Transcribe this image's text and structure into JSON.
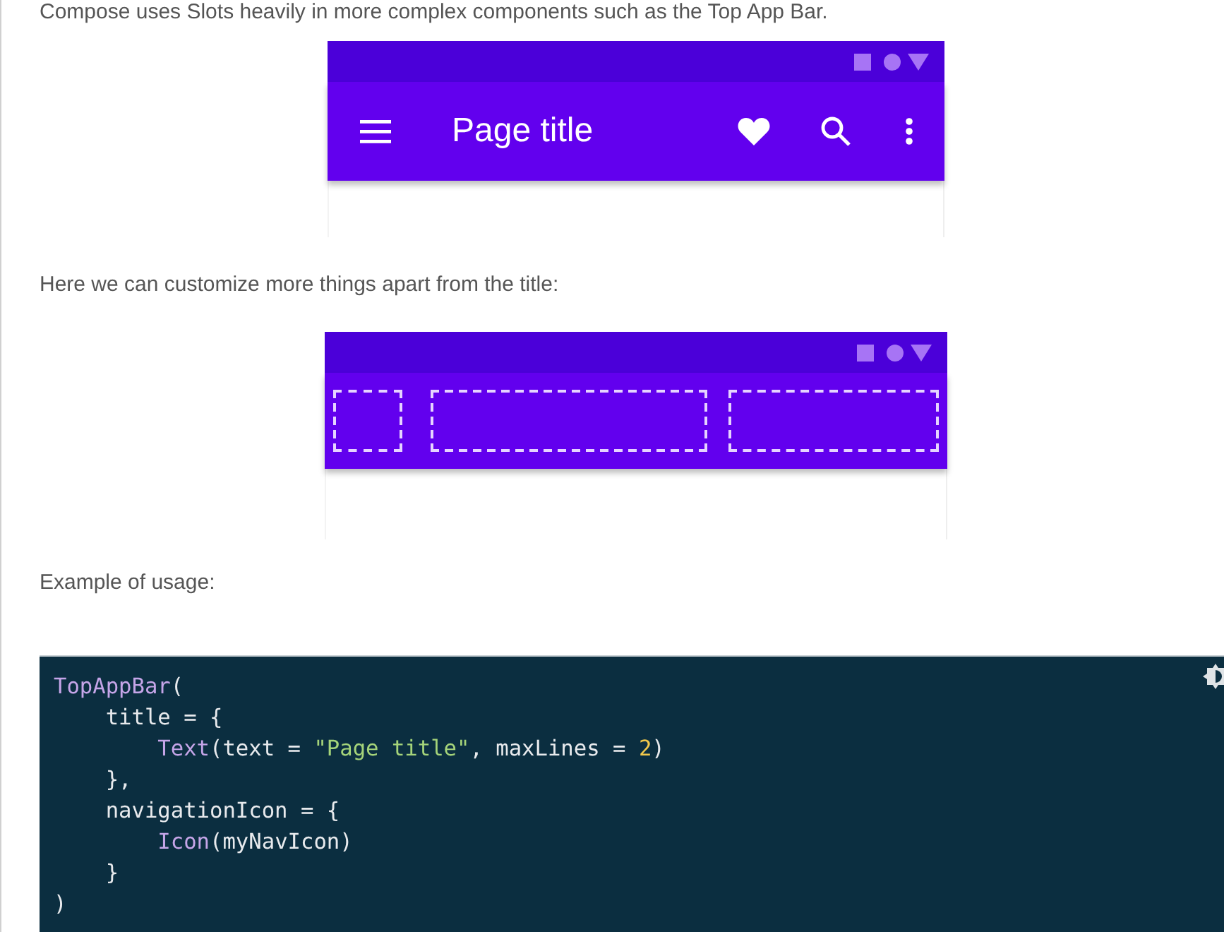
{
  "intro": "Compose uses Slots heavily in more complex components such as the Top App Bar.",
  "figures": [
    {
      "kind": "app_bar",
      "title": "Page title"
    },
    {
      "kind": "slots"
    }
  ],
  "paragraphs": [
    "Here we can customize more things apart from the title:",
    "Example of usage:"
  ],
  "code": {
    "lines": [
      [
        {
          "kind": "fn",
          "text": "TopAppBar"
        },
        {
          "kind": "plain",
          "text": "("
        }
      ],
      [
        {
          "kind": "plain",
          "text": "    title = {"
        }
      ],
      [
        {
          "kind": "fn",
          "text": "        Text"
        },
        {
          "kind": "plain",
          "text": "(text = "
        },
        {
          "kind": "string",
          "text": "\"Page title\""
        },
        {
          "kind": "plain",
          "text": ", maxLines = "
        },
        {
          "kind": "number",
          "text": "2"
        },
        {
          "kind": "plain",
          "text": ")"
        }
      ],
      [
        {
          "kind": "plain",
          "text": "    },"
        }
      ],
      [
        {
          "kind": "plain",
          "text": "    navigationIcon = {"
        }
      ],
      [
        {
          "kind": "fn",
          "text": "        Icon"
        },
        {
          "kind": "plain",
          "text": "(myNavIcon)"
        }
      ],
      [
        {
          "kind": "plain",
          "text": "    }"
        }
      ],
      [
        {
          "kind": "plain",
          "text": ")"
        }
      ]
    ]
  }
}
